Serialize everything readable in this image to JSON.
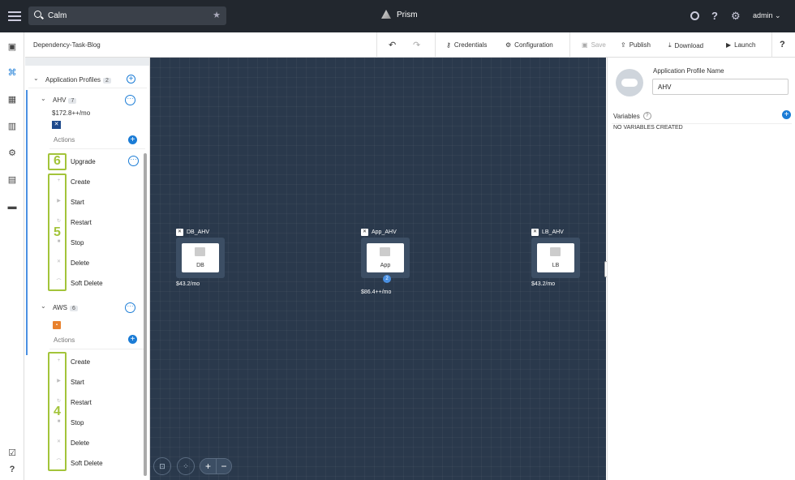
{
  "topbar": {
    "search_value": "Calm",
    "brand": "Prism",
    "user": "admin"
  },
  "toolbar": {
    "blueprint_name": "Dependency-Task-Blog",
    "credentials": "Credentials",
    "configuration": "Configuration",
    "save": "Save",
    "publish": "Publish",
    "download": "Download",
    "launch": "Launch",
    "help": "?"
  },
  "panel": {
    "app_profiles_label": "Application Profiles",
    "app_profiles_count": "2",
    "profiles": [
      {
        "name": "AHV",
        "count": "7",
        "cost": "$172.8++/mo",
        "actions_label": "Actions",
        "actions": [
          "Upgrade",
          "Create",
          "Start",
          "Restart",
          "Stop",
          "Delete",
          "Soft Delete"
        ]
      },
      {
        "name": "AWS",
        "count": "6",
        "actions_label": "Actions",
        "actions": [
          "Create",
          "Start",
          "Restart",
          "Stop",
          "Delete",
          "Soft Delete"
        ]
      }
    ],
    "callouts": [
      "6",
      "5",
      "4"
    ]
  },
  "canvas": {
    "services": [
      {
        "name": "DB_AHV",
        "tile": "DB",
        "cost": "$43.2/mo"
      },
      {
        "name": "App_AHV",
        "tile": "App",
        "cost": "$86.4++/mo",
        "replicas": "2"
      },
      {
        "name": "LB_AHV",
        "tile": "LB",
        "cost": "$43.2/mo"
      }
    ]
  },
  "right_panel": {
    "profile_name_label": "Application Profile Name",
    "profile_name_value": "AHV",
    "variables_label": "Variables",
    "no_variables": "NO VARIABLES CREATED"
  },
  "colors": {
    "topbar": "#22272e",
    "canvas": "#2a394c",
    "accent": "#1b7cd6",
    "highlight": "#a3c43a"
  }
}
